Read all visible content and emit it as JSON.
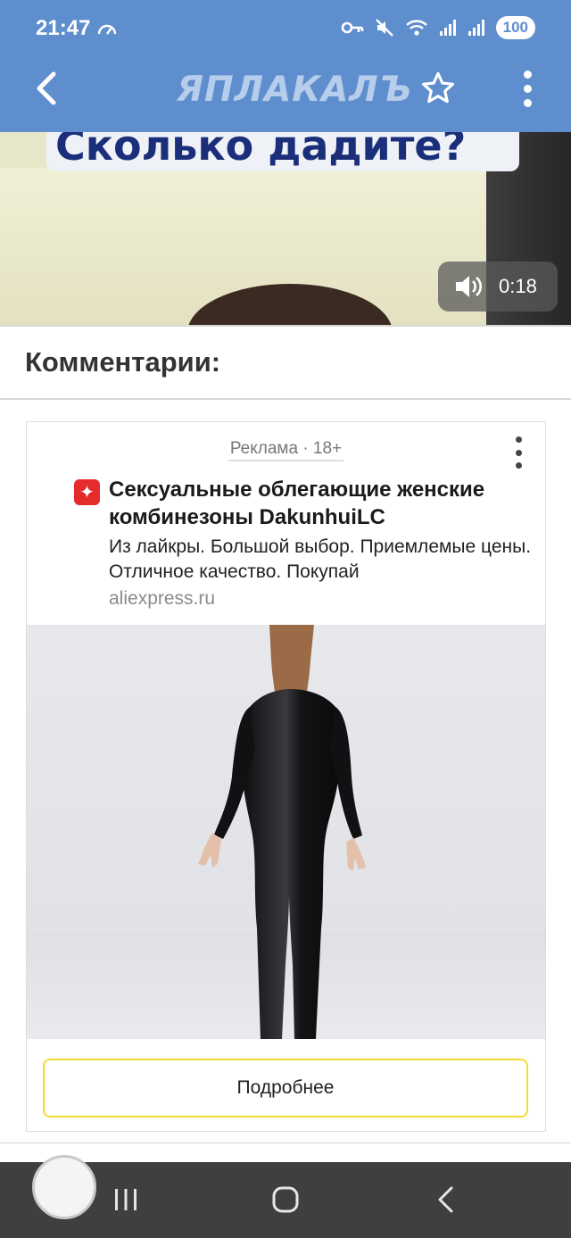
{
  "status_bar": {
    "time": "21:47",
    "battery": "100"
  },
  "app": {
    "logo": "ЯПЛАКАЛЪ",
    "accent_color": "#5f8ecf"
  },
  "video": {
    "caption": "Сколько дадите?",
    "duration": "0:18",
    "icons": [
      "speaker-icon"
    ]
  },
  "comments": {
    "title": "Комментарии:"
  },
  "ad": {
    "label": "Реклама · 18+",
    "title": "Сексуальные облегающие женские комбинезоны DakunhuiLC",
    "text": "Из лайкры. Большой выбор. Приемлемые цены. Отличное качество. Покупай",
    "domain": "aliexpress.ru",
    "cta": "Подробнее",
    "cta_border_color": "#f0db3a"
  },
  "system_nav": {
    "icons": [
      "recents-icon",
      "home-icon",
      "back-icon"
    ]
  }
}
